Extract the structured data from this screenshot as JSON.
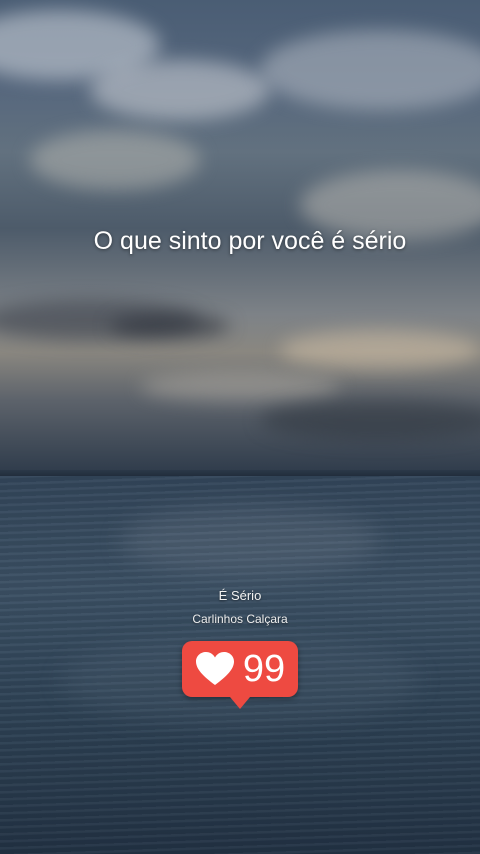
{
  "lyric": {
    "text": "O que sinto por você é sério"
  },
  "song": {
    "title": "É Sério",
    "artist": "Carlinhos Calçara"
  },
  "like_badge": {
    "icon": "heart-icon",
    "count": "99",
    "color": "#ee4a41"
  }
}
